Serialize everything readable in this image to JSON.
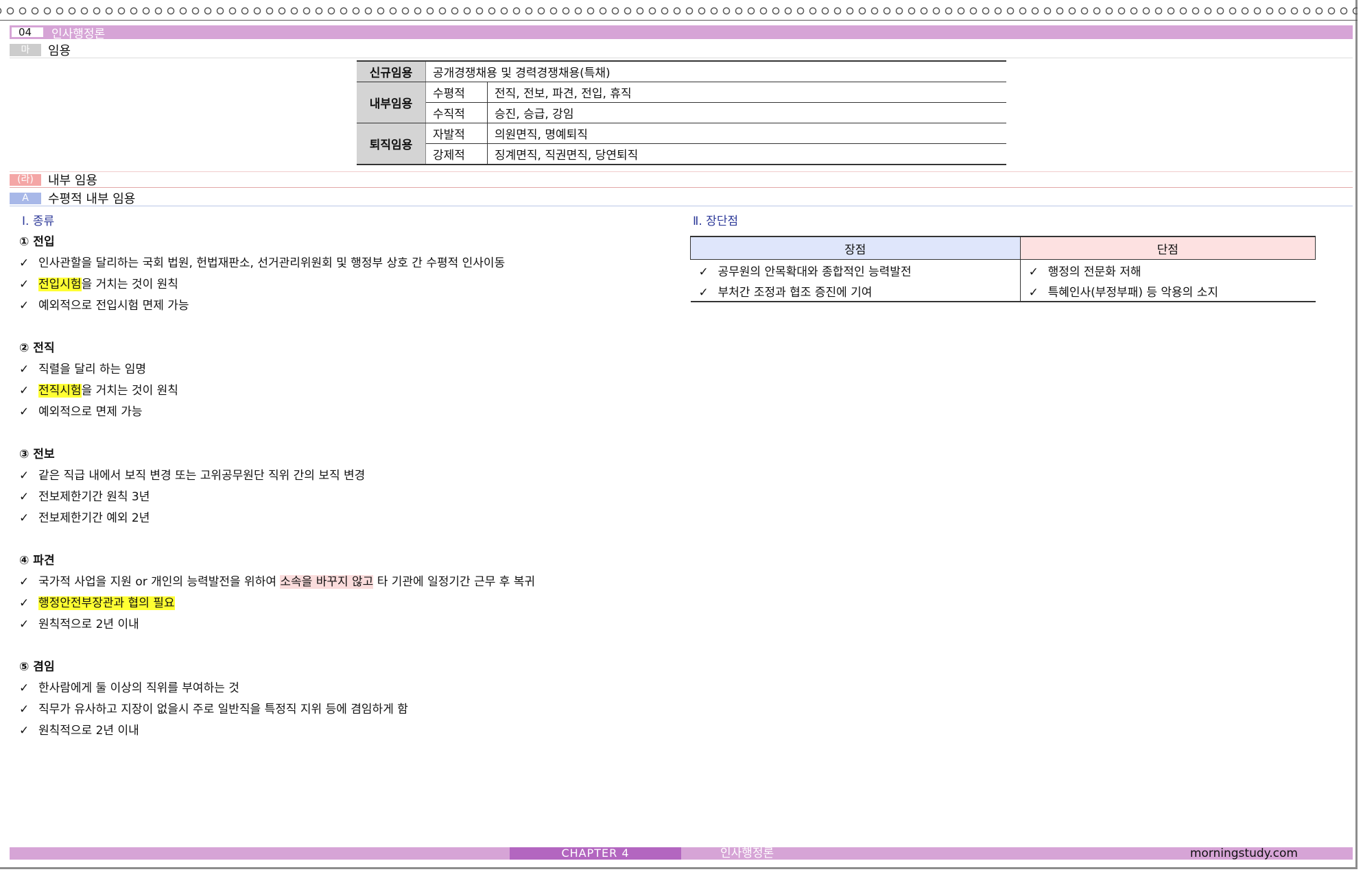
{
  "header": {
    "chapter_number": "04",
    "chapter_title": "인사행정론",
    "sub_mark": "마",
    "sub_title": "임용"
  },
  "appointment_table": {
    "rows": [
      {
        "category": "신규임용",
        "type": "",
        "content": "공개경쟁채용 및 경력경쟁채용(특채)"
      },
      {
        "category": "내부임용",
        "type": "수평적",
        "content": "전직, 전보, 파견, 전입, 휴직"
      },
      {
        "category": "",
        "type": "수직적",
        "content": "승진, 승급, 강임"
      },
      {
        "category": "퇴직임용",
        "type": "자발적",
        "content": "의원면직, 명예퇴직"
      },
      {
        "category": "",
        "type": "강제적",
        "content": "징계면직, 직권면직, 당연퇴직"
      }
    ]
  },
  "section": {
    "mark": "(라)",
    "title": "내부 임용"
  },
  "subsection": {
    "mark": "A",
    "title": "수평적 내부 임용"
  },
  "left": {
    "heading": "Ⅰ. 종류",
    "check": "✓",
    "groups": [
      {
        "title": "① 전입",
        "items": [
          {
            "pre": "인사관할을 달리하는 국회 법원, 헌법재판소, 선거관리위원회 및 행정부 상호 간 수평적 인사이동",
            "hl": "",
            "post": ""
          },
          {
            "pre": "",
            "hl": "전입시험",
            "post": "을 거치는 것이 원칙"
          },
          {
            "pre": "예외적으로 전입시험 면제 가능",
            "hl": "",
            "post": ""
          }
        ]
      },
      {
        "title": "② 전직",
        "items": [
          {
            "pre": "직렬을 달리 하는 임명",
            "hl": "",
            "post": ""
          },
          {
            "pre": "",
            "hl": "전직시험",
            "post": "을 거치는 것이 원칙"
          },
          {
            "pre": "예외적으로 면제 가능",
            "hl": "",
            "post": ""
          }
        ]
      },
      {
        "title": "③ 전보",
        "items": [
          {
            "pre": "같은 직급 내에서 보직 변경 또는 고위공무원단 직위 간의 보직 변경",
            "hl": "",
            "post": ""
          },
          {
            "pre": "전보제한기간 원칙 3년",
            "hl": "",
            "post": ""
          },
          {
            "pre": "전보제한기간 예외 2년",
            "hl": "",
            "post": ""
          }
        ]
      },
      {
        "title": "④ 파견",
        "items": [
          {
            "pre": "국가적 사업을 지원 or 개인의 능력발전을 위하여 ",
            "pink": "소속을 바꾸지 않고",
            "post": " 타 기관에 일정기간 근무 후 복귀"
          },
          {
            "pre": "",
            "hl": "행정안전부장관과 협의 필요",
            "post": ""
          },
          {
            "pre": "원칙적으로 2년 이내",
            "hl": "",
            "post": ""
          }
        ]
      },
      {
        "title": "⑤ 겸임",
        "items": [
          {
            "pre": "한사람에게 둘 이상의 직위를 부여하는 것",
            "hl": "",
            "post": ""
          },
          {
            "pre": "직무가 유사하고 지장이 없을시 주로 일반직을 특정직 지위 등에 겸임하게 함",
            "hl": "",
            "post": ""
          },
          {
            "pre": "원칙적으로 2년 이내",
            "hl": "",
            "post": ""
          }
        ]
      }
    ]
  },
  "right": {
    "heading": "Ⅱ. 장단점",
    "pros_header": "장점",
    "cons_header": "단점",
    "rows": [
      {
        "pro": "공무원의 안목확대와 종합적인 능력발전",
        "con": "행정의 전문화 저해"
      },
      {
        "pro": "부처간 조정과 협조 증진에 기여",
        "con": "특혜인사(부정부패) 등 악용의 소지"
      }
    ]
  },
  "footer": {
    "chapter": "CHAPTER 4",
    "title": "인사행정론",
    "site": "morningstudy.com"
  }
}
